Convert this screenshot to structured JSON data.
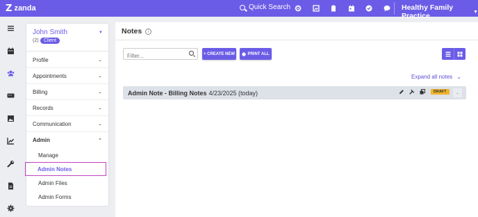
{
  "app": {
    "logo_mark": "Z",
    "logo_text": "zanda",
    "quick_search_label": "Quick Search",
    "practice_name": "Healthy Family Practice",
    "top_icons": [
      "settings-icon",
      "reports-icon",
      "clipboard-icon",
      "calendar-icon",
      "check-circle-icon",
      "chat-icon"
    ]
  },
  "rail": {
    "items": [
      "menu-icon",
      "calendar-icon",
      "clients-icon",
      "billing-icon",
      "image-icon",
      "chart-icon",
      "wrench-icon",
      "document-icon",
      "settings-icon"
    ]
  },
  "client": {
    "name": "John Smith",
    "count": "(2)",
    "badge": "Client"
  },
  "nav": {
    "items": [
      {
        "label": "Profile"
      },
      {
        "label": "Appointments"
      },
      {
        "label": "Billing"
      },
      {
        "label": "Records"
      },
      {
        "label": "Communication"
      },
      {
        "label": "Admin"
      }
    ],
    "admin_sub": [
      {
        "label": "Manage"
      },
      {
        "label": "Admin Notes"
      },
      {
        "label": "Admin Files"
      },
      {
        "label": "Admin Forms"
      }
    ]
  },
  "notes": {
    "title": "Notes",
    "filter_placeholder": "Filter...",
    "create_label": "+ CREATE NEW",
    "print_label": "PRINT ALL",
    "expand_all_label": "Expand all notes",
    "rows": [
      {
        "title": "Admin Note - Billing Notes",
        "date": "4/23/2025 (today)",
        "status": "DRAFT"
      }
    ]
  },
  "colors": {
    "brand": "#6b5ce7",
    "draft": "#f0b429",
    "highlight": "#c044c0"
  }
}
